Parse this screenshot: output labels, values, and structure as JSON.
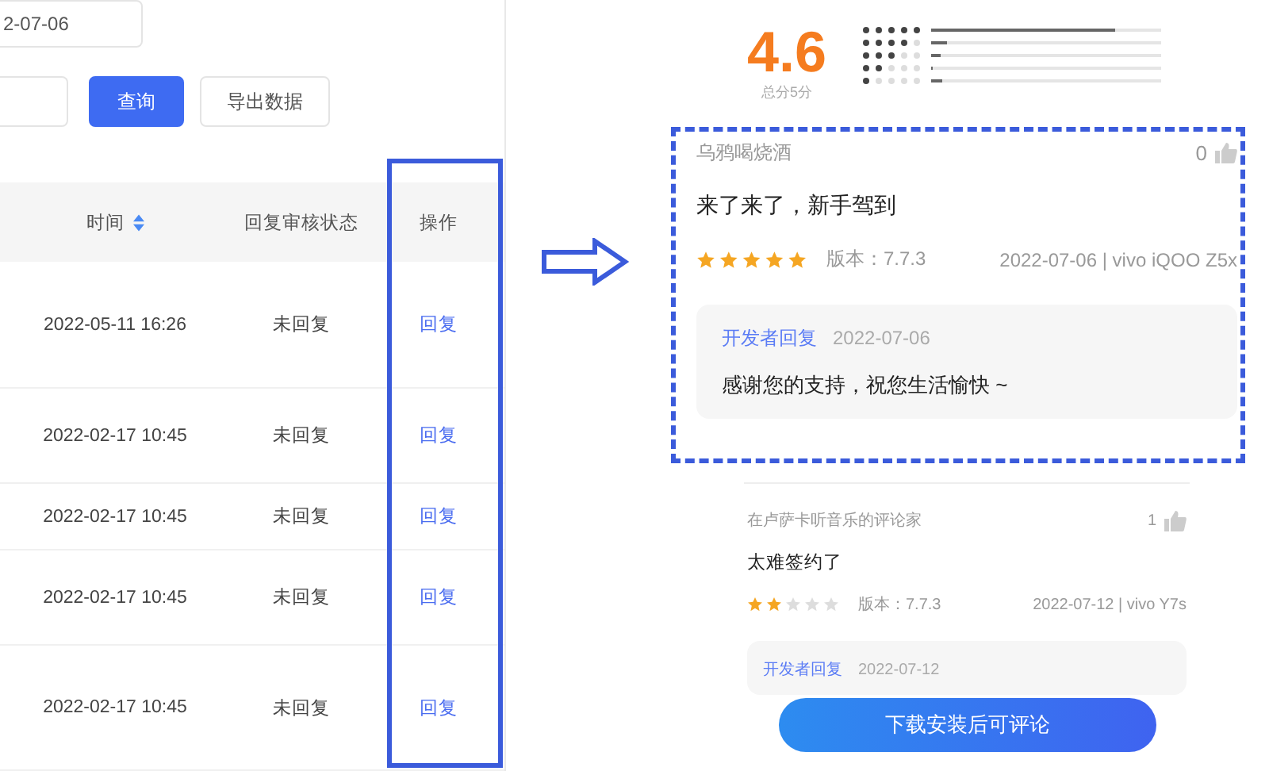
{
  "filters": {
    "date_value": "2-07-06",
    "query_button": "查询",
    "export_button": "导出数据"
  },
  "table": {
    "columns": [
      {
        "label": "时间",
        "sortable": true
      },
      {
        "label": "回复审核状态",
        "sortable": false
      },
      {
        "label": "操作",
        "sortable": false
      }
    ],
    "rows": [
      {
        "time": "2022-05-11 16:26",
        "status": "未回复",
        "action": "回复"
      },
      {
        "time": "2022-02-17 10:45",
        "status": "未回复",
        "action": "回复"
      },
      {
        "time": "2022-02-17 10:45",
        "status": "未回复",
        "action": "回复"
      },
      {
        "time": "2022-02-17 10:45",
        "status": "未回复",
        "action": "回复"
      },
      {
        "time": "2022-02-17 10:45",
        "status": "未回复",
        "action": "回复"
      }
    ]
  },
  "app_reviews": {
    "rating": "4.6",
    "rating_caption": "总分5分",
    "distribution": [
      {
        "stars": 5,
        "level": 0.8
      },
      {
        "stars": 4,
        "level": 0.07
      },
      {
        "stars": 3,
        "level": 0.04
      },
      {
        "stars": 2,
        "level": 0.01
      },
      {
        "stars": 1,
        "level": 0.05
      }
    ],
    "reviews": [
      {
        "author": "乌鸦喝烧酒",
        "likes": "0",
        "text": "来了来了，新手驾到",
        "stars": 5,
        "version": "版本：7.7.3",
        "meta": "2022-07-06 | vivo iQOO Z5x",
        "reply": {
          "label": "开发者回复",
          "date": "2022-07-06",
          "text": "感谢您的支持，祝您生活愉快 ~"
        }
      },
      {
        "author": "在卢萨卡听音乐的评论家",
        "likes": "1",
        "text": "太难签约了",
        "stars": 2,
        "version": "版本：7.7.3",
        "meta": "2022-07-12 | vivo Y7s",
        "reply": {
          "label": "开发者回复",
          "date": "2022-07-12"
        }
      }
    ],
    "install_button": "下载安装后可评论"
  }
}
